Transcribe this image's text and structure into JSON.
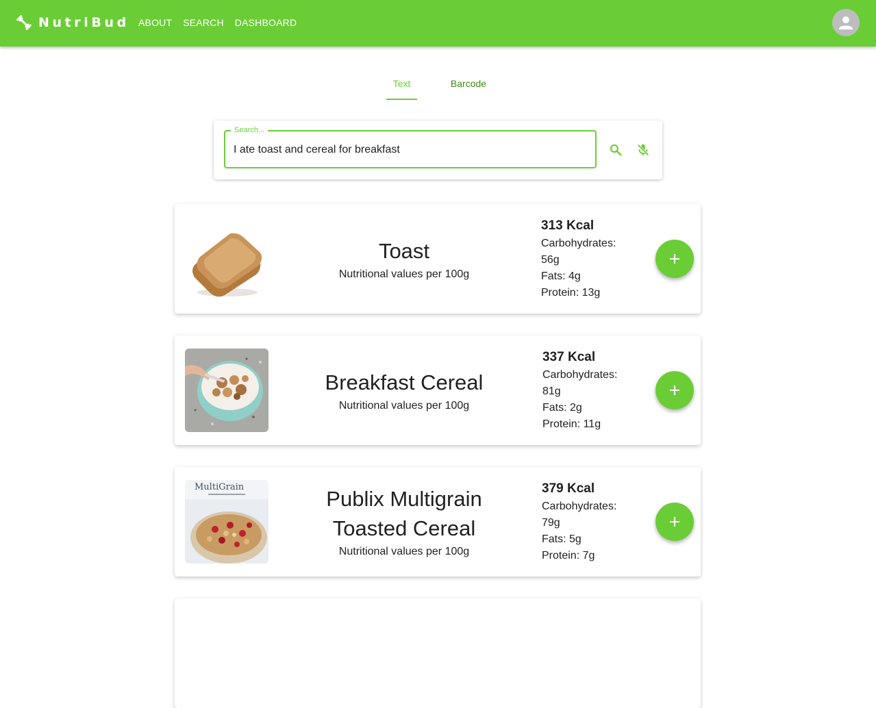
{
  "brand": {
    "name": "NutriBud",
    "icon": "fitness-dumbbell-icon"
  },
  "nav": {
    "about": "ABOUT",
    "search": "SEARCH",
    "dashboard": "DASHBOARD"
  },
  "user": {
    "avatar_icon": "person-icon"
  },
  "tabs": [
    {
      "label": "Text",
      "active": true
    },
    {
      "label": "Barcode",
      "active": false
    }
  ],
  "search": {
    "label": "Search...",
    "value": "I ate toast and cereal for breakfast",
    "search_icon": "search-icon",
    "mic_icon": "mic-off-icon"
  },
  "results": [
    {
      "name": "Toast",
      "subtitle": "Nutritional values per 100g",
      "kcal": "313 Kcal",
      "carbs_label": "Carbohydrates:",
      "carbs": "56g",
      "fats": "Fats: 4g",
      "protein": "Protein: 13g",
      "image": "toast-photo"
    },
    {
      "name": "Breakfast Cereal",
      "subtitle": "Nutritional values per 100g",
      "kcal": "337 Kcal",
      "carbs_label": "Carbohydrates:",
      "carbs": "81g",
      "fats": "Fats: 2g",
      "protein": "Protein: 11g",
      "image": "cereal-bowl-photo"
    },
    {
      "name": "Publix Multigrain Toasted Cereal",
      "subtitle": "Nutritional values per 100g",
      "kcal": "379 Kcal",
      "carbs_label": "Carbohydrates:",
      "carbs": "79g",
      "fats": "Fats: 5g",
      "protein": "Protein: 7g",
      "image": "multigrain-box-photo",
      "image_text": "MultiGrain"
    }
  ],
  "colors": {
    "primary": "#6acd36",
    "dark_green": "#3b8c14",
    "avatar_bg": "#bdbdbd"
  }
}
